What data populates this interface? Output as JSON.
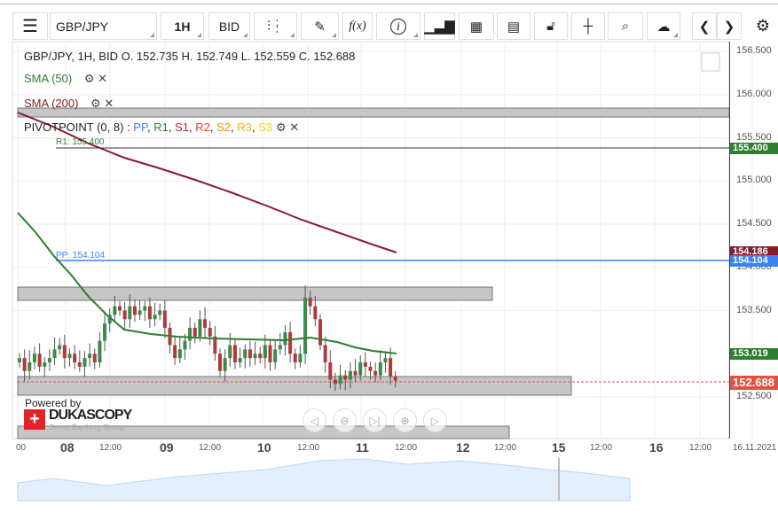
{
  "toolbar": {
    "menu": "menu-icon",
    "symbol": "GBP/JPY",
    "period": "1H",
    "side": "BID",
    "fx": "f(x)",
    "info": "i"
  },
  "legend": {
    "ohlc": "GBP/JPY, 1H, BID   O. 152.735 H. 152.749 L. 152.559 C. 152.688",
    "sma50": "SMA (50)",
    "sma200": "SMA (200)",
    "pivot": "PIVOTPOINT (0, 8)",
    "pivot_sep": " : ",
    "pivot_items": [
      {
        "t": "PP",
        "c": "#3b82f6"
      },
      {
        "t": "R1",
        "c": "#2e7d32"
      },
      {
        "t": "S1",
        "c": "#c62828"
      },
      {
        "t": "R2",
        "c": "#e53935"
      },
      {
        "t": "S2",
        "c": "#fb8c00"
      },
      {
        "t": "R3",
        "c": "#ffb300"
      },
      {
        "t": "S3",
        "c": "#f5d000"
      }
    ]
  },
  "lines": {
    "r1": "R1: 155.400",
    "pp": "PP: 154.104"
  },
  "price_scale": [
    "156.500",
    "156.000",
    "155.500",
    "155.000",
    "154.500",
    "154.000",
    "153.500",
    "152.500"
  ],
  "tags": {
    "r1": "155.400",
    "sma200": "154.186",
    "pp": "154.104",
    "sma50": "153.019",
    "last": "152.688"
  },
  "colors": {
    "r1": "#2e7d32",
    "sma200": "#8b1a2b",
    "pp": "#3b82f6",
    "sma50": "#2e7d32",
    "last": "#e0533f"
  },
  "time_axis": [
    {
      "t": "00",
      "b": false
    },
    {
      "t": "08",
      "b": true
    },
    {
      "t": "12:00",
      "b": false
    },
    {
      "t": "09",
      "b": true
    },
    {
      "t": "12:00",
      "b": false
    },
    {
      "t": "10",
      "b": true
    },
    {
      "t": "12:00",
      "b": false
    },
    {
      "t": "11",
      "b": true
    },
    {
      "t": "12:00",
      "b": false
    },
    {
      "t": "12",
      "b": true
    },
    {
      "t": "12:00",
      "b": false
    },
    {
      "t": "15",
      "b": true
    },
    {
      "t": "12:00",
      "b": false
    },
    {
      "t": "16",
      "b": true
    },
    {
      "t": "12:00",
      "b": false
    },
    {
      "t": "16.11.2021",
      "b": false
    }
  ],
  "branding": {
    "powered": "Powered by",
    "logo": "DUKASCOPY",
    "sub": "Swiss Banking Group"
  },
  "closes": [
    152.95,
    152.8,
    152.9,
    153.0,
    152.85,
    152.9,
    152.95,
    153.05,
    153.1,
    152.95,
    153.0,
    152.9,
    152.85,
    152.95,
    153.0,
    152.9,
    153.15,
    153.35,
    153.45,
    153.55,
    153.5,
    153.4,
    153.55,
    153.45,
    153.5,
    153.55,
    153.4,
    153.45,
    153.5,
    153.3,
    153.1,
    152.95,
    153.05,
    153.15,
    153.3,
    153.2,
    153.4,
    153.3,
    153.2,
    153.0,
    152.8,
    152.95,
    153.1,
    152.9,
    152.95,
    153.05,
    152.95,
    153.0,
    152.95,
    153.1,
    152.9,
    153.05,
    153.1,
    153.25,
    153.0,
    152.9,
    153.0,
    153.65,
    153.55,
    153.4,
    153.1,
    152.9,
    152.7,
    152.65,
    152.75,
    152.7,
    152.8,
    152.75,
    152.9,
    152.85,
    152.8,
    152.75,
    152.9,
    152.95,
    152.74,
    152.69
  ]
}
